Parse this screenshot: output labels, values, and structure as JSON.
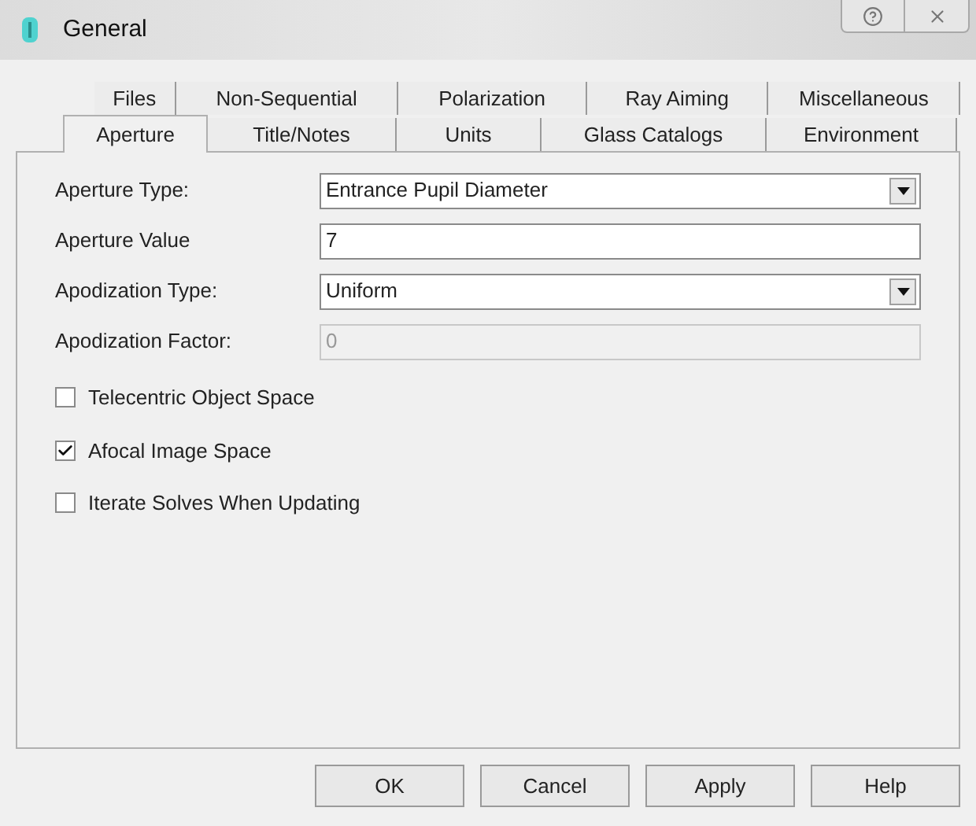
{
  "window": {
    "title": "General"
  },
  "tab_rows": [
    [
      {
        "label": "Files",
        "selected": false
      },
      {
        "label": "Non-Sequential",
        "selected": false
      },
      {
        "label": "Polarization",
        "selected": false
      },
      {
        "label": "Ray Aiming",
        "selected": false
      },
      {
        "label": "Miscellaneous",
        "selected": false
      }
    ],
    [
      {
        "label": "Aperture",
        "selected": true
      },
      {
        "label": "Title/Notes",
        "selected": false
      },
      {
        "label": "Units",
        "selected": false
      },
      {
        "label": "Glass Catalogs",
        "selected": false
      },
      {
        "label": "Environment",
        "selected": false
      }
    ]
  ],
  "fields": [
    {
      "label": "Aperture Type:",
      "kind": "dropdown",
      "value": "Entrance Pupil Diameter",
      "disabled": false
    },
    {
      "label": "Aperture Value",
      "kind": "text",
      "value": "7",
      "disabled": false
    },
    {
      "label": "Apodization Type:",
      "kind": "dropdown",
      "value": "Uniform",
      "disabled": false
    },
    {
      "label": "Apodization Factor:",
      "kind": "text",
      "value": "0",
      "disabled": true
    }
  ],
  "checkboxes": [
    {
      "label": "Telecentric Object Space",
      "checked": false
    },
    {
      "label": "Afocal Image Space",
      "checked": true
    },
    {
      "label": "Iterate Solves When Updating",
      "checked": false
    }
  ],
  "buttons": [
    "OK",
    "Cancel",
    "Apply",
    "Help"
  ]
}
